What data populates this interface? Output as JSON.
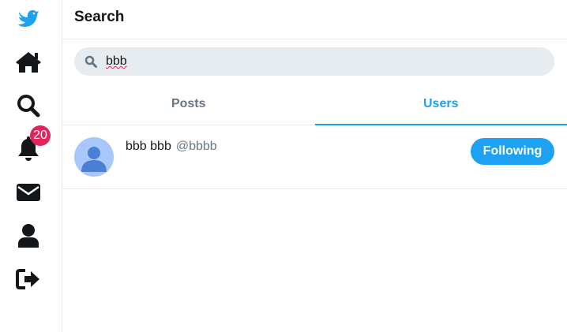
{
  "sidebar": {
    "items": [
      {
        "icon": "bird-logo-icon",
        "color": "#1da1f2"
      },
      {
        "icon": "home-icon"
      },
      {
        "icon": "search-icon"
      },
      {
        "icon": "bell-icon",
        "badge": "20"
      },
      {
        "icon": "envelope-icon"
      },
      {
        "icon": "user-icon"
      },
      {
        "icon": "sign-out-icon"
      }
    ]
  },
  "header": {
    "title": "Search"
  },
  "search": {
    "value": "bbb",
    "icon": "search-icon"
  },
  "tabs": [
    {
      "label": "Posts",
      "active": false
    },
    {
      "label": "Users",
      "active": true
    }
  ],
  "results": [
    {
      "name": "bbb bbb",
      "handle": "@bbbb",
      "button_label": "Following"
    }
  ],
  "colors": {
    "accent": "#1da1f2",
    "badge": "#e0245e",
    "text": "#14171a",
    "muted": "#657786",
    "border": "#e6ecf0"
  }
}
